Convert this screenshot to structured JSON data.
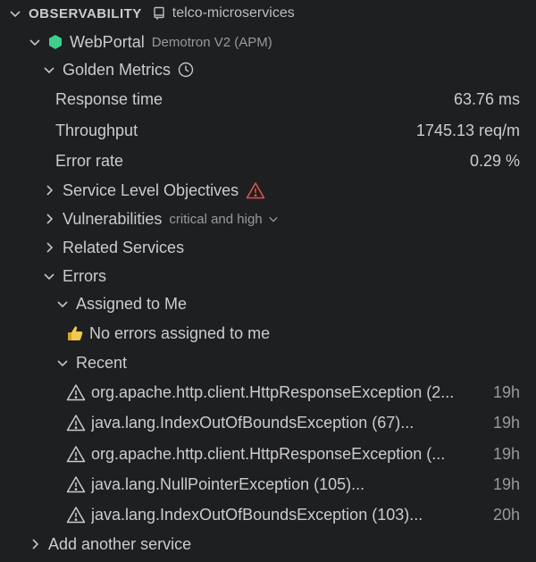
{
  "header": {
    "title": "OBSERVABILITY",
    "repo": "telco-microservices"
  },
  "entity": {
    "name": "WebPortal",
    "account": "Demotron V2 (APM)",
    "status_color": "#3ecf8e"
  },
  "golden_metrics": {
    "label": "Golden Metrics",
    "metrics": [
      {
        "name": "Response time",
        "value": "63.76 ms"
      },
      {
        "name": "Throughput",
        "value": "1745.13 req/m"
      },
      {
        "name": "Error rate",
        "value": "0.29 %"
      }
    ]
  },
  "sections": {
    "slo": "Service Level Objectives",
    "vulnerabilities": "Vulnerabilities",
    "vulnerabilities_filter": "critical and high",
    "related": "Related Services",
    "errors": "Errors"
  },
  "errors": {
    "assigned_label": "Assigned to Me",
    "assigned_empty": "No errors assigned to me",
    "recent_label": "Recent",
    "recent": [
      {
        "text": "org.apache.http.client.HttpResponseException (2...",
        "time": "19h"
      },
      {
        "text": "java.lang.IndexOutOfBoundsException (67)...",
        "time": "19h"
      },
      {
        "text": "org.apache.http.client.HttpResponseException (...",
        "time": "19h"
      },
      {
        "text": "java.lang.NullPointerException (105)...",
        "time": "19h"
      },
      {
        "text": "java.lang.IndexOutOfBoundsException (103)...",
        "time": "20h"
      }
    ]
  },
  "footer": {
    "add_service": "Add another service"
  },
  "colors": {
    "warning_red": "#e2514b",
    "thumb_yellow": "#f2c94c"
  }
}
